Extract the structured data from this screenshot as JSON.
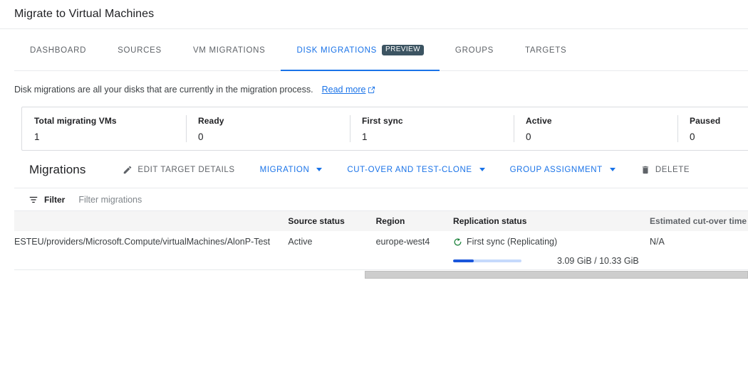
{
  "header": {
    "title": "Migrate to Virtual Machines"
  },
  "tabs": [
    {
      "label": "DASHBOARD",
      "active": false,
      "badge": null
    },
    {
      "label": "SOURCES",
      "active": false,
      "badge": null
    },
    {
      "label": "VM MIGRATIONS",
      "active": false,
      "badge": null
    },
    {
      "label": "DISK MIGRATIONS",
      "active": true,
      "badge": "PREVIEW"
    },
    {
      "label": "GROUPS",
      "active": false,
      "badge": null
    },
    {
      "label": "TARGETS",
      "active": false,
      "badge": null
    }
  ],
  "description": {
    "text": "Disk migrations are all your disks that are currently in the migration process.",
    "link_label": "Read more",
    "link_icon": "external-link-icon"
  },
  "metrics": [
    {
      "label": "Total migrating VMs",
      "value": "1"
    },
    {
      "label": "Ready",
      "value": "0"
    },
    {
      "label": "First sync",
      "value": "1"
    },
    {
      "label": "Active",
      "value": "0"
    },
    {
      "label": "Paused",
      "value": "0"
    }
  ],
  "toolbar": {
    "title": "Migrations",
    "edit_target_details": "EDIT TARGET DETAILS",
    "migration": "MIGRATION",
    "cutover_test_clone": "CUT-OVER AND TEST-CLONE",
    "group_assignment": "GROUP ASSIGNMENT",
    "delete": "DELETE"
  },
  "filter": {
    "label": "Filter",
    "placeholder": "Filter migrations",
    "value": ""
  },
  "table": {
    "columns": [
      {
        "key": "name",
        "label": ""
      },
      {
        "key": "source_status",
        "label": "Source status"
      },
      {
        "key": "region",
        "label": "Region"
      },
      {
        "key": "replication_status",
        "label": "Replication status"
      },
      {
        "key": "estimated_cutover",
        "label": "Estimated cut-over time"
      }
    ],
    "rows": [
      {
        "name": "ESTEU/providers/Microsoft.Compute/virtualMachines/AlonP-Test",
        "source_status": "Active",
        "region": "europe-west4",
        "replication_status": "First sync (Replicating)",
        "replication_icon": "sync-circle-icon",
        "progress_percent": 30,
        "progress_text": "3.09 GiB / 10.33 GiB",
        "estimated_cutover": "N/A"
      }
    ]
  },
  "colors": {
    "accent_blue": "#1a73e8",
    "progress_fill": "#1a56db",
    "progress_track": "#c6dafc",
    "sync_green": "#188038",
    "badge_bg": "#3c5462",
    "header_band": "#f5f5f5"
  }
}
